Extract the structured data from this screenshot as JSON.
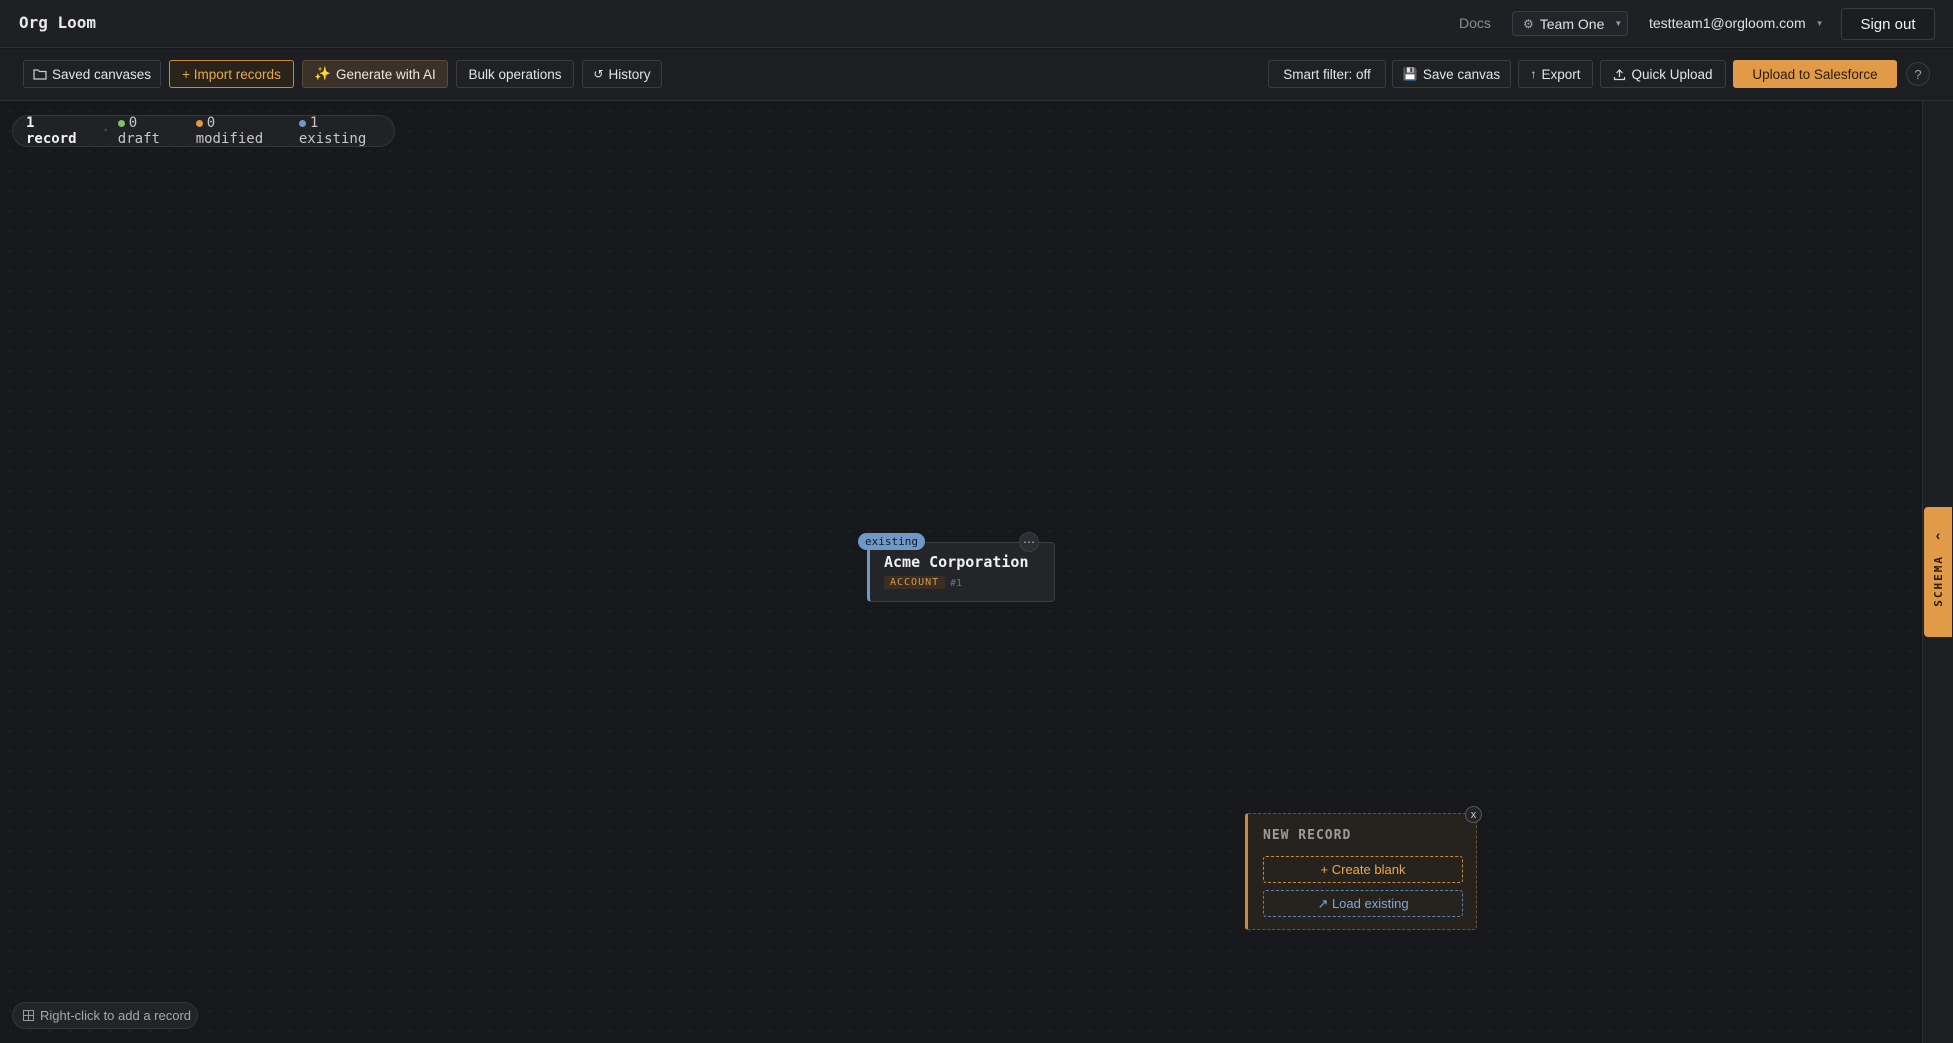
{
  "header": {
    "brand": "Org Loom",
    "docs": "Docs",
    "team": "Team One",
    "email": "testteam1@orgloom.com",
    "signout": "Sign out"
  },
  "toolbar": {
    "saved_canvases": "Saved canvases",
    "import_records": "+ Import records",
    "generate_ai": "Generate with AI",
    "bulk_operations": "Bulk operations",
    "history": "History",
    "smart_filter": "Smart filter: off",
    "save_canvas": "Save canvas",
    "export": "Export",
    "quick_upload": "Quick Upload",
    "upload_salesforce": "Upload to Salesforce",
    "help": "?"
  },
  "stats": {
    "records": "1 record",
    "draft": "0 draft",
    "modified": "0 modified",
    "existing": "1 existing"
  },
  "colors": {
    "draft": "#7ec26a",
    "modified": "#e09a48",
    "existing": "#6f98c9",
    "accent": "#e09a48"
  },
  "card": {
    "badge": "existing",
    "title": "Acme Corporation",
    "type": "ACCOUNT",
    "number": "#1",
    "menu": "⋯"
  },
  "new_record": {
    "title": "NEW RECORD",
    "create_blank": "+ Create blank",
    "load_existing": "↗ Load existing",
    "close": "x"
  },
  "hint": "Right-click to add a record",
  "schema": {
    "label": "SCHEMA"
  }
}
